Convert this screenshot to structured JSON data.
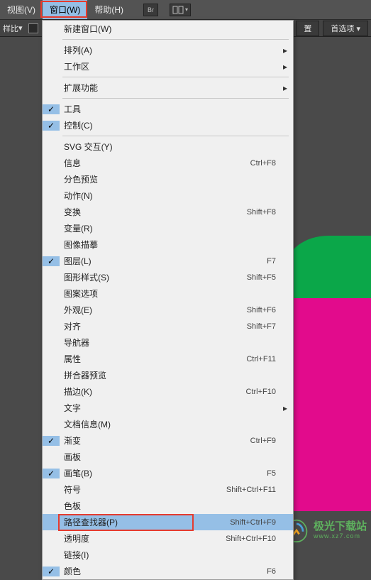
{
  "menubar": {
    "items": [
      "视图(V)",
      "窗口(W)",
      "帮助(H)"
    ],
    "active_index": 1,
    "icon_labels": [
      "Br",
      ""
    ]
  },
  "toolbar": {
    "left_label": "样比",
    "right_buttons": [
      "置",
      "首选项"
    ]
  },
  "dropdown": {
    "sections": [
      [
        {
          "label": "新建窗口(W)",
          "shortcut": "",
          "checked": false,
          "arrow": false
        }
      ],
      [
        {
          "label": "排列(A)",
          "shortcut": "",
          "checked": false,
          "arrow": true
        },
        {
          "label": "工作区",
          "shortcut": "",
          "checked": false,
          "arrow": true
        }
      ],
      [
        {
          "label": "扩展功能",
          "shortcut": "",
          "checked": false,
          "arrow": true
        }
      ],
      [
        {
          "label": "工具",
          "shortcut": "",
          "checked": true,
          "arrow": false
        },
        {
          "label": "控制(C)",
          "shortcut": "",
          "checked": true,
          "arrow": false
        }
      ],
      [
        {
          "label": "SVG 交互(Y)",
          "shortcut": "",
          "checked": false,
          "arrow": false
        },
        {
          "label": "信息",
          "shortcut": "Ctrl+F8",
          "checked": false,
          "arrow": false
        },
        {
          "label": "分色预览",
          "shortcut": "",
          "checked": false,
          "arrow": false
        },
        {
          "label": "动作(N)",
          "shortcut": "",
          "checked": false,
          "arrow": false
        },
        {
          "label": "变换",
          "shortcut": "Shift+F8",
          "checked": false,
          "arrow": false
        },
        {
          "label": "变量(R)",
          "shortcut": "",
          "checked": false,
          "arrow": false
        },
        {
          "label": "图像描摹",
          "shortcut": "",
          "checked": false,
          "arrow": false
        },
        {
          "label": "图层(L)",
          "shortcut": "F7",
          "checked": true,
          "arrow": false
        },
        {
          "label": "图形样式(S)",
          "shortcut": "Shift+F5",
          "checked": false,
          "arrow": false
        },
        {
          "label": "图案选项",
          "shortcut": "",
          "checked": false,
          "arrow": false
        },
        {
          "label": "外观(E)",
          "shortcut": "Shift+F6",
          "checked": false,
          "arrow": false
        },
        {
          "label": "对齐",
          "shortcut": "Shift+F7",
          "checked": false,
          "arrow": false
        },
        {
          "label": "导航器",
          "shortcut": "",
          "checked": false,
          "arrow": false
        },
        {
          "label": "属性",
          "shortcut": "Ctrl+F11",
          "checked": false,
          "arrow": false
        },
        {
          "label": "拼合器预览",
          "shortcut": "",
          "checked": false,
          "arrow": false
        },
        {
          "label": "描边(K)",
          "shortcut": "Ctrl+F10",
          "checked": false,
          "arrow": false
        },
        {
          "label": "文字",
          "shortcut": "",
          "checked": false,
          "arrow": true
        },
        {
          "label": "文档信息(M)",
          "shortcut": "",
          "checked": false,
          "arrow": false
        },
        {
          "label": "渐变",
          "shortcut": "Ctrl+F9",
          "checked": true,
          "arrow": false
        },
        {
          "label": "画板",
          "shortcut": "",
          "checked": false,
          "arrow": false
        },
        {
          "label": "画笔(B)",
          "shortcut": "F5",
          "checked": true,
          "arrow": false
        },
        {
          "label": "符号",
          "shortcut": "Shift+Ctrl+F11",
          "checked": false,
          "arrow": false
        },
        {
          "label": "色板",
          "shortcut": "",
          "checked": false,
          "arrow": false
        },
        {
          "label": "路径查找器(P)",
          "shortcut": "Shift+Ctrl+F9",
          "checked": false,
          "arrow": false,
          "highlighted": true,
          "redbox": true
        },
        {
          "label": "透明度",
          "shortcut": "Shift+Ctrl+F10",
          "checked": false,
          "arrow": false
        },
        {
          "label": "链接(I)",
          "shortcut": "",
          "checked": false,
          "arrow": false
        },
        {
          "label": "颜色",
          "shortcut": "F6",
          "checked": true,
          "arrow": false
        }
      ]
    ]
  },
  "watermark": {
    "title": "极光下载站",
    "sub": "www.xz7.com"
  }
}
